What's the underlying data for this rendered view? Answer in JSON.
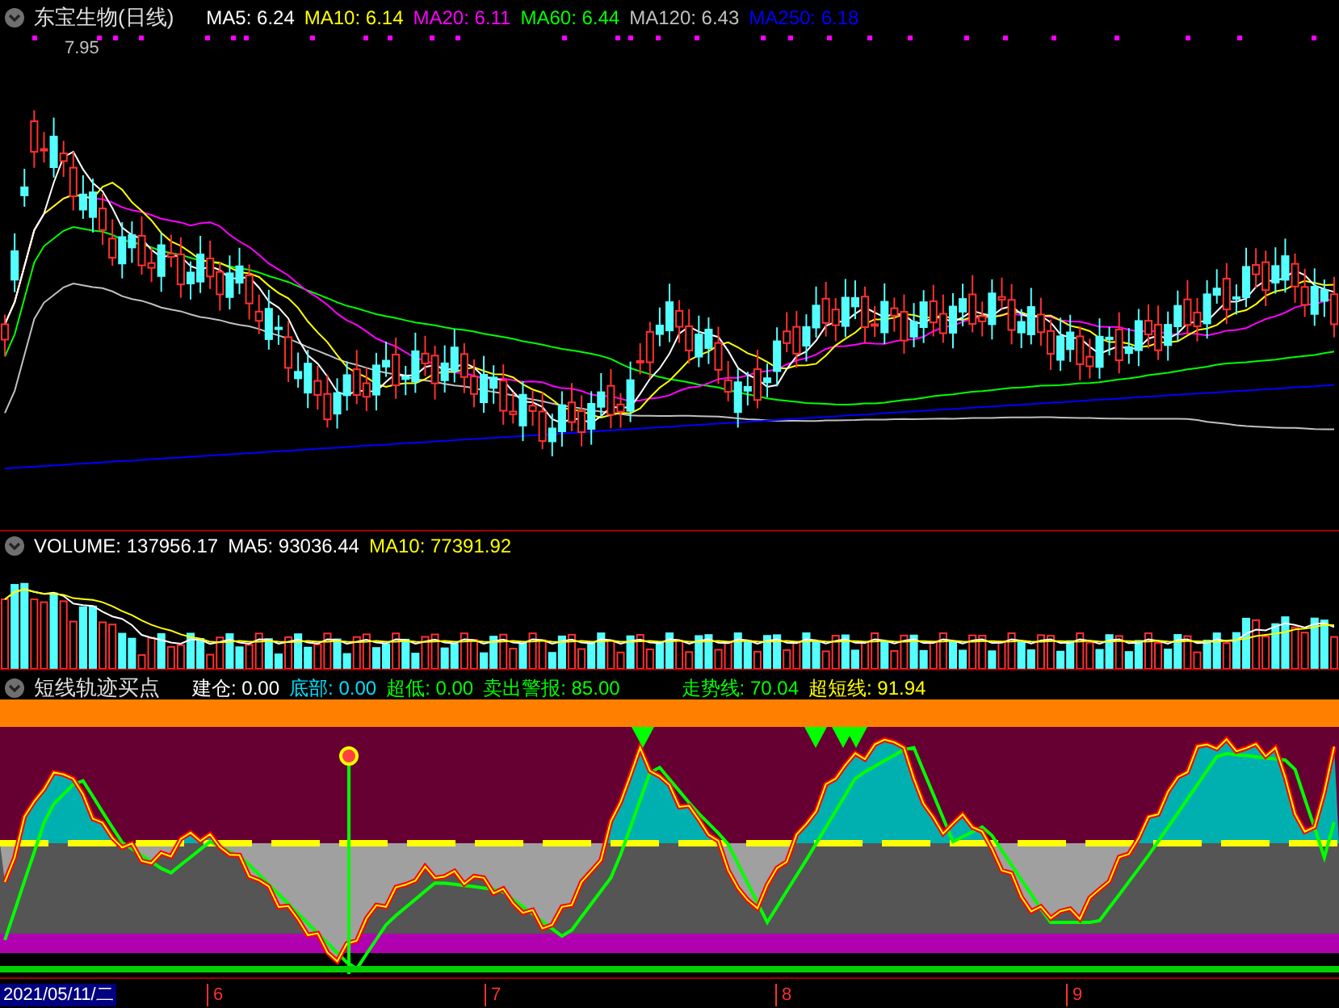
{
  "price_panel": {
    "title": "东宝生物(日线)",
    "indicators": [
      {
        "label": "MA5: 6.24",
        "color": "#ffffff"
      },
      {
        "label": "MA10: 6.14",
        "color": "#ffff00"
      },
      {
        "label": "MA20: 6.11",
        "color": "#ff00ff"
      },
      {
        "label": "MA60: 6.44",
        "color": "#00ff00"
      },
      {
        "label": "MA120: 6.43",
        "color": "#c0c0c0"
      },
      {
        "label": "MA250: 6.18",
        "color": "#0000ff"
      }
    ],
    "high_marker": "7.95"
  },
  "volume_panel": {
    "indicators": [
      {
        "label": "VOLUME: 137956.17",
        "color": "#ffffff"
      },
      {
        "label": "MA5: 93036.44",
        "color": "#ffffff"
      },
      {
        "label": "MA10: 77391.92",
        "color": "#ffff00"
      }
    ]
  },
  "signal_panel": {
    "title": "短线轨迹买点",
    "indicators": [
      {
        "label": "建仓: 0.00",
        "color": "#ffffff"
      },
      {
        "label": "底部: 0.00",
        "color": "#00e0ff"
      },
      {
        "label": "超低: 0.00",
        "color": "#00ff00"
      },
      {
        "label": "卖出警报: 85.00",
        "color": "#00ff00"
      },
      {
        "label": "走势线: 70.04",
        "color": "#00ff00"
      },
      {
        "label": "超短线: 91.94",
        "color": "#ffff00"
      }
    ]
  },
  "time_axis": {
    "labels": [
      "2021/05/11/二",
      "6",
      "7",
      "8",
      "9"
    ]
  }
}
